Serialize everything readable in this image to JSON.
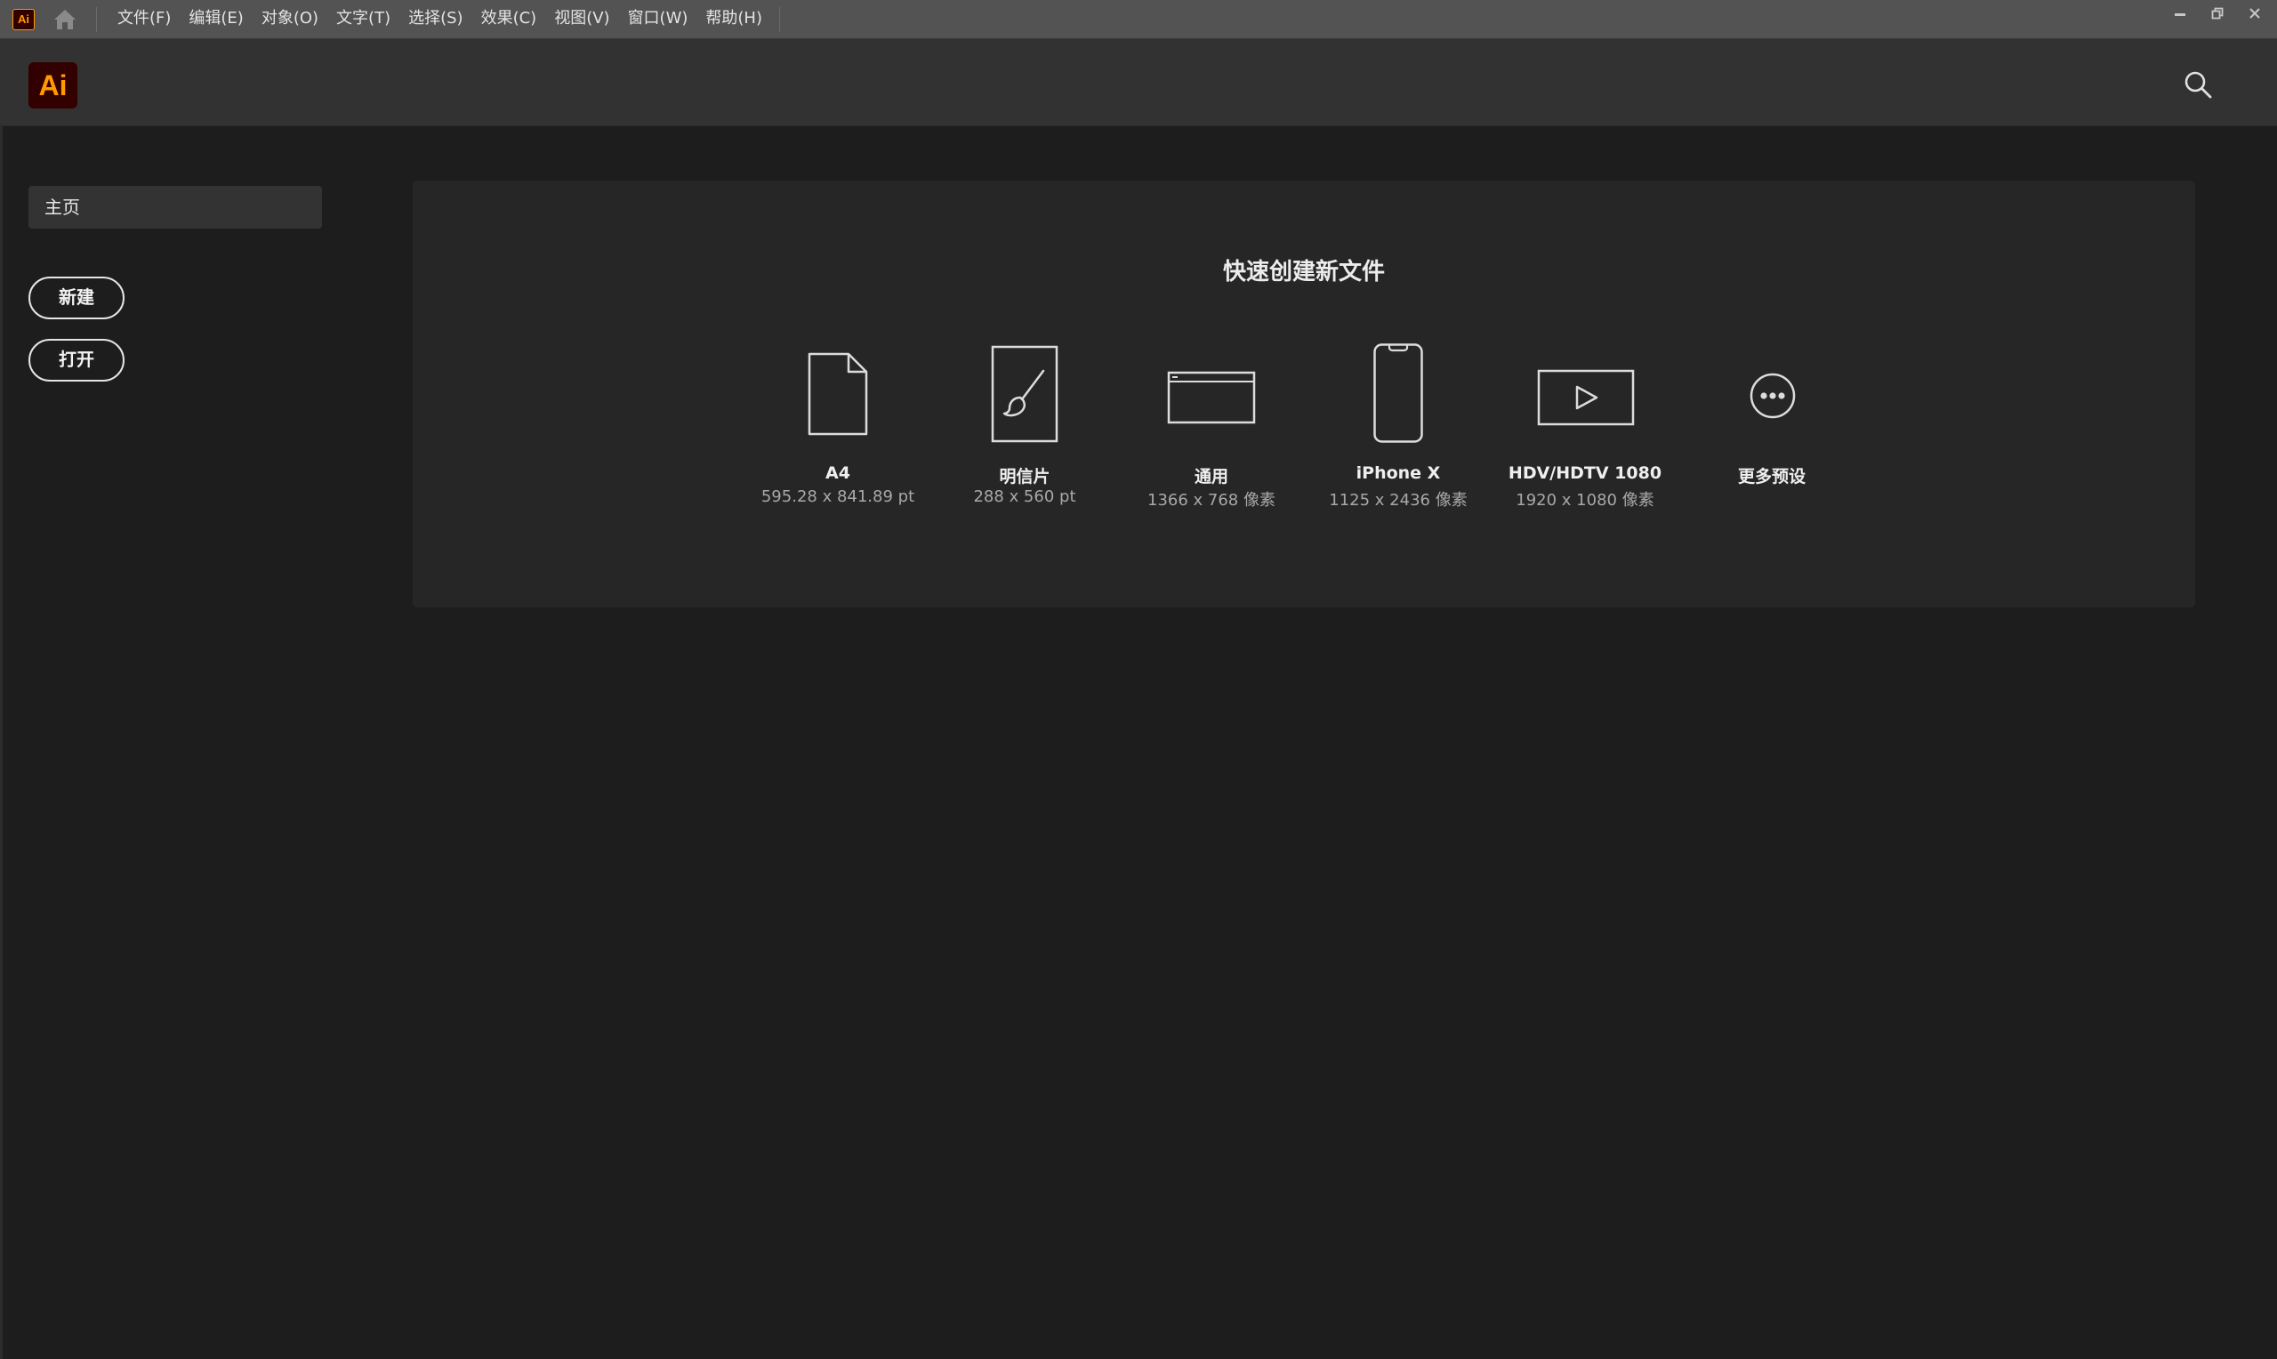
{
  "menubar": {
    "app_icon_label": "Ai",
    "items": [
      "文件(F)",
      "编辑(E)",
      "对象(O)",
      "文字(T)",
      "选择(S)",
      "效果(C)",
      "视图(V)",
      "窗口(W)",
      "帮助(H)"
    ]
  },
  "header": {
    "logo_text": "Ai"
  },
  "sidebar": {
    "home_label": "主页",
    "new_label": "新建",
    "open_label": "打开"
  },
  "quick_create": {
    "title": "快速创建新文件",
    "presets": [
      {
        "name": "A4",
        "size": "595.28 x 841.89 pt",
        "icon": "document-icon"
      },
      {
        "name": "明信片",
        "size": "288 x 560 pt",
        "icon": "postcard-brush-icon"
      },
      {
        "name": "通用",
        "size": "1366 x 768 像素",
        "icon": "browser-window-icon"
      },
      {
        "name": "iPhone X",
        "size": "1125 x 2436 像素",
        "icon": "phone-icon"
      },
      {
        "name": "HDV/HDTV 1080",
        "size": "1920 x 1080 像素",
        "icon": "video-play-icon"
      },
      {
        "name": "更多预设",
        "size": "",
        "icon": "more-ellipsis-icon"
      }
    ]
  },
  "colors": {
    "brand_orange": "#ff9a00",
    "brand_dark": "#330000",
    "menubar_bg": "#535353",
    "header_bg": "#323232",
    "canvas_bg": "#1d1d1d",
    "panel_bg": "#262626"
  }
}
